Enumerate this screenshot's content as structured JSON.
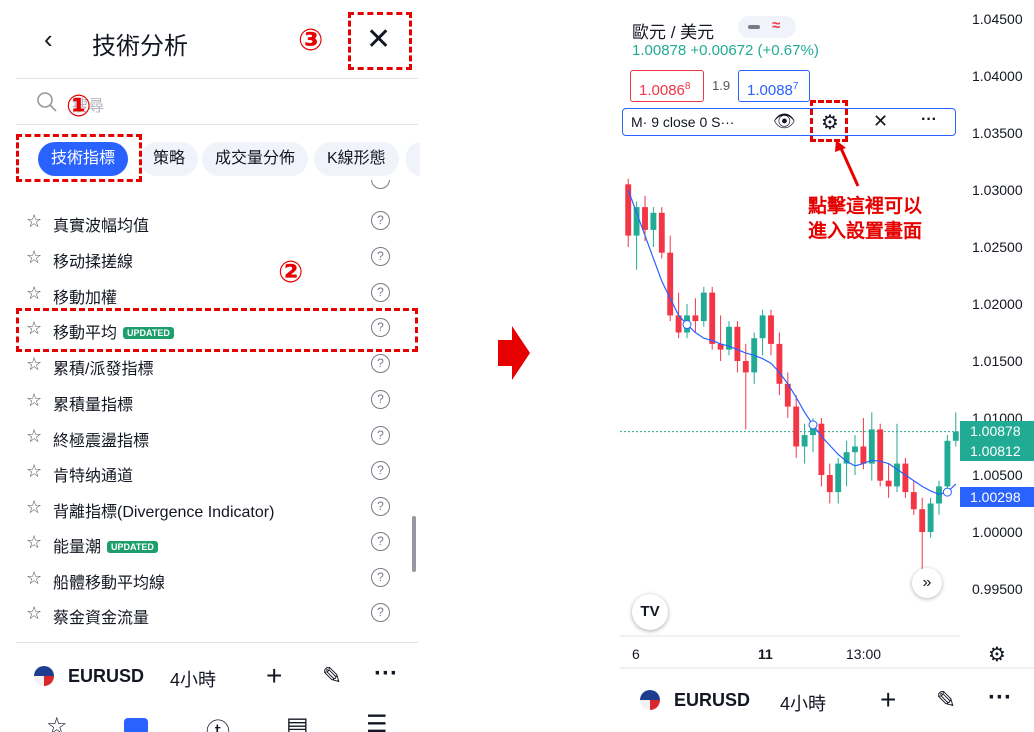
{
  "left": {
    "header": {
      "title": "技術分析",
      "back_icon": "chevron-left-icon",
      "close_icon": "close-icon"
    },
    "search": {
      "placeholder": "搜尋"
    },
    "tabs": [
      {
        "label": "技術指標",
        "active": true
      },
      {
        "label": "策略"
      },
      {
        "label": "成交量分佈"
      },
      {
        "label": "K線形態"
      }
    ],
    "indicators": [
      {
        "label": "真實波幅均值"
      },
      {
        "label": "移动揉搓線"
      },
      {
        "label": "移動加權"
      },
      {
        "label": "移動平均",
        "badge": "UPDATED"
      },
      {
        "label": "累積/派發指標"
      },
      {
        "label": "累積量指標"
      },
      {
        "label": "終極震盪指標"
      },
      {
        "label": "肯特纳通道"
      },
      {
        "label": "背離指標(Divergence Indicator)"
      },
      {
        "label": "能量潮",
        "badge": "UPDATED"
      },
      {
        "label": "船體移動平均線"
      },
      {
        "label": "蔡金資金流量"
      }
    ],
    "bottom": {
      "symbol": "EURUSD",
      "timeframe": "4小時"
    },
    "annotations": {
      "n1": "①",
      "n2": "②",
      "n3": "③"
    }
  },
  "right": {
    "pair": "歐元 / 美元",
    "quote": "1.00878 +0.00672 (+0.67%)",
    "sell_price": "1.0086",
    "sell_sup": "8",
    "spread": "1.9",
    "buy_price": "1.0088",
    "buy_sup": "7",
    "indicator_label": "M· 9 close 0 S···",
    "note_lines": [
      "點擊這裡可以",
      "進入設置畫面"
    ],
    "y_ticks": [
      "1.04500",
      "1.04000",
      "1.03500",
      "1.03000",
      "1.02500",
      "1.02000",
      "1.01500",
      "1.01000",
      "1.00500",
      "1.00000",
      "0.99500"
    ],
    "price_labels": [
      "1.00878",
      "1.00812",
      "1.00298"
    ],
    "x_ticks": [
      "6",
      "11",
      "13:00"
    ],
    "tv_logo": "TV",
    "bottom": {
      "symbol": "EURUSD",
      "timeframe": "4小時"
    }
  },
  "colors": {
    "accent": "#2962ff",
    "up": "#22ab94",
    "down": "#f23645",
    "annotation": "#e60000",
    "ma": "#2962ff"
  },
  "chart_data": {
    "type": "candlestick",
    "ma_label": "M· 9 close 0 S···",
    "ylim": [
      0.995,
      1.045
    ],
    "candles": [
      [
        1.0305,
        1.031,
        1.025,
        1.026
      ],
      [
        1.026,
        1.029,
        1.023,
        1.0285
      ],
      [
        1.0285,
        1.0295,
        1.0255,
        1.0265
      ],
      [
        1.0265,
        1.0285,
        1.025,
        1.028
      ],
      [
        1.028,
        1.0285,
        1.024,
        1.0245
      ],
      [
        1.0245,
        1.026,
        1.0185,
        1.019
      ],
      [
        1.019,
        1.021,
        1.017,
        1.0175
      ],
      [
        1.0175,
        1.02,
        1.017,
        1.019
      ],
      [
        1.019,
        1.0205,
        1.0175,
        1.0185
      ],
      [
        1.0185,
        1.0215,
        1.018,
        1.021
      ],
      [
        1.021,
        1.0215,
        1.016,
        1.0165
      ],
      [
        1.0165,
        1.019,
        1.015,
        1.016
      ],
      [
        1.016,
        1.0185,
        1.0155,
        1.018
      ],
      [
        1.018,
        1.0185,
        1.014,
        1.015
      ],
      [
        1.015,
        1.0165,
        1.009,
        1.014
      ],
      [
        1.014,
        1.0175,
        1.013,
        1.017
      ],
      [
        1.017,
        1.0195,
        1.0155,
        1.019
      ],
      [
        1.019,
        1.0195,
        1.0155,
        1.0165
      ],
      [
        1.0165,
        1.0175,
        1.012,
        1.013
      ],
      [
        1.013,
        1.014,
        1.01,
        1.011
      ],
      [
        1.011,
        1.012,
        1.0065,
        1.0075
      ],
      [
        1.0075,
        1.0095,
        1.006,
        1.0085
      ],
      [
        1.0085,
        1.01,
        1.007,
        1.0095
      ],
      [
        1.0095,
        1.01,
        1.004,
        1.005
      ],
      [
        1.005,
        1.006,
        1.0025,
        1.0035
      ],
      [
        1.0035,
        1.0065,
        1.0025,
        1.006
      ],
      [
        1.006,
        1.008,
        1.004,
        1.007
      ],
      [
        1.007,
        1.0085,
        1.005,
        1.0075
      ],
      [
        1.0075,
        1.01,
        1.0055,
        1.006
      ],
      [
        1.006,
        1.0105,
        1.0045,
        1.009
      ],
      [
        1.009,
        1.0095,
        1.004,
        1.0045
      ],
      [
        1.0045,
        1.006,
        1.003,
        1.004
      ],
      [
        1.004,
        1.0095,
        1.0035,
        1.006
      ],
      [
        1.006,
        1.0065,
        1.003,
        1.0035
      ],
      [
        1.0035,
        1.0045,
        1.0015,
        1.002
      ],
      [
        1.002,
        1.003,
        0.9965,
        1.0
      ],
      [
        1.0,
        1.003,
        0.9995,
        1.0025
      ],
      [
        1.0025,
        1.0045,
        1.0015,
        1.004
      ],
      [
        1.004,
        1.0085,
        1.0035,
        1.008
      ],
      [
        1.008,
        1.0105,
        1.0075,
        1.0088
      ]
    ],
    "ma": [
      1.03,
      1.028,
      1.026,
      1.024,
      1.022,
      1.0205,
      1.019,
      1.0182,
      1.0175,
      1.017,
      1.0168,
      1.0165,
      1.0163,
      1.016,
      1.0157,
      1.0155,
      1.0152,
      1.0148,
      1.014,
      1.013,
      1.0118,
      1.0105,
      1.0094,
      1.0084,
      1.0076,
      1.0068,
      1.0062,
      1.0058,
      1.006,
      1.0063,
      1.0062,
      1.006,
      1.0055,
      1.005,
      1.0045,
      1.004,
      1.0036,
      1.0033,
      1.0035,
      1.0042
    ]
  }
}
